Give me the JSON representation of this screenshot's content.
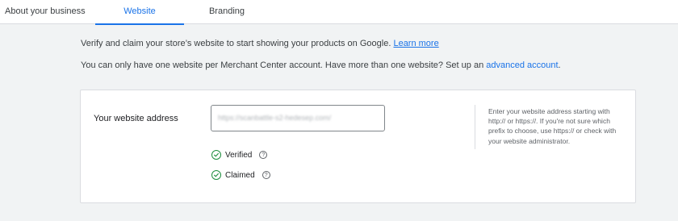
{
  "tabs": {
    "about": "About your business",
    "website": "Website",
    "branding": "Branding"
  },
  "intro": {
    "line1_text": "Verify and claim your store’s website to start showing your products on Google.",
    "line1_link": "Learn more",
    "line2_text": "You can only have one website per Merchant Center account. Have more than one website? Set up an",
    "line2_link": "advanced account",
    "line2_end": "."
  },
  "website_form": {
    "label": "Your website address",
    "input_value": "https://scanbattle-s2-hedesep.com/",
    "verified_label": "Verified",
    "claimed_label": "Claimed",
    "hint": "Enter your website address starting with http:// or https://. If you're not sure which prefix to choose, use https:// or check with your website administrator."
  },
  "icons": {
    "help": "?",
    "check": "check-circle-icon"
  },
  "colors": {
    "accent": "#1a73e8",
    "success": "#1e8e3e",
    "background": "#f1f3f4"
  }
}
